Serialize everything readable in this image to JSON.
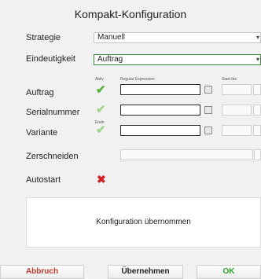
{
  "window": {
    "title": "Kompakt-Konfiguration"
  },
  "form": {
    "strategie": {
      "label": "Strategie",
      "value": "Manuell"
    },
    "eindeutigkeit": {
      "label": "Eindeutigkeit",
      "value": "Auftrag"
    },
    "column_headers": {
      "aktiv": "Aktiv",
      "regex": "Regular Expression",
      "start": "Start-Idx",
      "ende": "Ende"
    },
    "rows": [
      {
        "label": "Auftrag",
        "checked": true
      },
      {
        "label": "Serialnummer",
        "checked": false
      },
      {
        "label": "Variante",
        "checked": false
      }
    ],
    "zerschneiden": {
      "label": "Zerschneiden"
    },
    "autostart": {
      "label": "Autostart",
      "checked": false
    }
  },
  "message": "Konfiguration übernommen",
  "buttons": {
    "abbruch": "Abbruch",
    "uebernehmen": "Übernehmen",
    "ok": "OK"
  },
  "colors": {
    "check_active": "#5ab03a",
    "check_inactive": "#9fd28a",
    "cancel": "#c0392b",
    "ok": "#2e9e2e"
  },
  "icons": {
    "select_arrow": "▾",
    "check": "✔",
    "cross": "✖"
  }
}
